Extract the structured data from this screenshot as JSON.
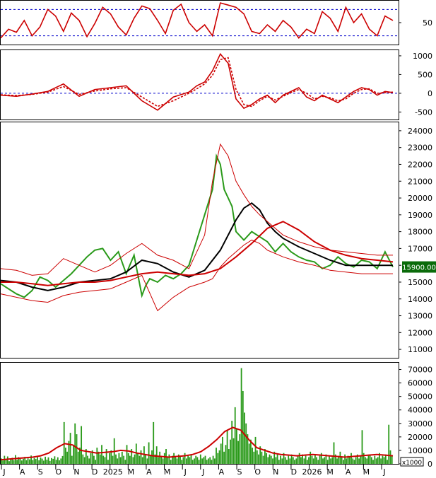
{
  "chart_data": [
    {
      "panel": "oscillator",
      "type": "line",
      "ylim": [
        0,
        100
      ],
      "reference_levels": [
        20,
        80
      ],
      "ticks": [
        50
      ],
      "series": [
        {
          "color": "#cc0000",
          "x": [
            0,
            0.02,
            0.04,
            0.06,
            0.08,
            0.1,
            0.12,
            0.14,
            0.16,
            0.18,
            0.2,
            0.22,
            0.24,
            0.26,
            0.28,
            0.3,
            0.32,
            0.34,
            0.36,
            0.38,
            0.4,
            0.42,
            0.44,
            0.46,
            0.48,
            0.5,
            0.52,
            0.54,
            0.56,
            0.58,
            0.6,
            0.62,
            0.64,
            0.66,
            0.68,
            0.7,
            0.72,
            0.74,
            0.76,
            0.78,
            0.8,
            0.82,
            0.84,
            0.86,
            0.88,
            0.9,
            0.92,
            0.94,
            0.96,
            0.98,
            1.0
          ],
          "values": [
            15,
            35,
            28,
            55,
            20,
            40,
            80,
            65,
            30,
            72,
            55,
            18,
            48,
            85,
            70,
            40,
            22,
            60,
            88,
            82,
            55,
            25,
            78,
            92,
            50,
            30,
            45,
            20,
            95,
            90,
            85,
            70,
            30,
            25,
            45,
            30,
            55,
            40,
            15,
            35,
            25,
            75,
            60,
            30,
            85,
            50,
            70,
            35,
            20,
            65,
            55
          ]
        }
      ]
    },
    {
      "panel": "macd",
      "type": "line",
      "ylim": [
        -700,
        1150
      ],
      "reference_levels": [
        0
      ],
      "ticks": [
        1000,
        500,
        0,
        -500
      ],
      "series": [
        {
          "color": "#cc0000",
          "x": [
            0,
            0.04,
            0.08,
            0.12,
            0.16,
            0.2,
            0.24,
            0.28,
            0.32,
            0.36,
            0.4,
            0.44,
            0.48,
            0.5,
            0.52,
            0.54,
            0.56,
            0.58,
            0.6,
            0.62,
            0.64,
            0.66,
            0.68,
            0.7,
            0.72,
            0.74,
            0.76,
            0.78,
            0.8,
            0.82,
            0.84,
            0.86,
            0.88,
            0.9,
            0.92,
            0.94,
            0.96,
            0.98,
            1.0
          ],
          "values": [
            -50,
            -80,
            -20,
            50,
            250,
            -80,
            100,
            150,
            200,
            -200,
            -450,
            -100,
            30,
            200,
            300,
            600,
            1050,
            800,
            -150,
            -400,
            -300,
            -150,
            -50,
            -250,
            -50,
            50,
            150,
            -100,
            -200,
            -50,
            -150,
            -250,
            -100,
            50,
            150,
            100,
            -50,
            50,
            20
          ]
        },
        {
          "color": "#cc0000",
          "dashed": true,
          "x": [
            0,
            0.04,
            0.08,
            0.12,
            0.16,
            0.2,
            0.24,
            0.28,
            0.32,
            0.36,
            0.4,
            0.44,
            0.48,
            0.5,
            0.52,
            0.54,
            0.56,
            0.58,
            0.6,
            0.62,
            0.64,
            0.66,
            0.68,
            0.7,
            0.72,
            0.74,
            0.76,
            0.78,
            0.8,
            0.82,
            0.84,
            0.86,
            0.88,
            0.9,
            0.92,
            0.94,
            0.96,
            0.98,
            1.0
          ],
          "values": [
            -40,
            -60,
            -30,
            30,
            180,
            -30,
            60,
            120,
            150,
            -100,
            -350,
            -200,
            0,
            120,
            250,
            480,
            900,
            950,
            100,
            -300,
            -350,
            -200,
            -80,
            -180,
            -80,
            20,
            100,
            0,
            -150,
            -80,
            -120,
            -200,
            -150,
            0,
            100,
            120,
            0,
            20,
            30
          ]
        }
      ]
    },
    {
      "panel": "price",
      "type": "line",
      "ylim": [
        10500,
        24500
      ],
      "yticks": [
        24000,
        23000,
        22000,
        21000,
        20000,
        19000,
        18000,
        17000,
        16000,
        15000,
        14000,
        13000,
        12000,
        11000
      ],
      "last_price": "15900.00",
      "x_labels": [
        "J",
        "A",
        "S",
        "O",
        "N",
        "D",
        "2025",
        "M",
        "A",
        "M",
        "J",
        "J",
        "A",
        "S",
        "O",
        "N",
        "D",
        "2026",
        "M",
        "A",
        "M",
        "J"
      ],
      "series": [
        {
          "color": "#2a9a1a",
          "x": [
            0,
            0.02,
            0.04,
            0.06,
            0.08,
            0.1,
            0.12,
            0.14,
            0.16,
            0.18,
            0.2,
            0.22,
            0.24,
            0.26,
            0.28,
            0.3,
            0.32,
            0.34,
            0.36,
            0.37,
            0.38,
            0.4,
            0.42,
            0.44,
            0.46,
            0.48,
            0.5,
            0.52,
            0.54,
            0.55,
            0.56,
            0.57,
            0.58,
            0.59,
            0.6,
            0.62,
            0.64,
            0.66,
            0.68,
            0.7,
            0.72,
            0.74,
            0.76,
            0.78,
            0.8,
            0.82,
            0.84,
            0.86,
            0.88,
            0.9,
            0.92,
            0.94,
            0.96,
            0.98,
            1.0
          ],
          "values": [
            14900,
            14600,
            14300,
            14100,
            14500,
            15300,
            15100,
            14700,
            15100,
            15500,
            16000,
            16500,
            16900,
            17000,
            16300,
            16800,
            15500,
            16600,
            14200,
            14800,
            15200,
            15000,
            15400,
            15200,
            15500,
            16000,
            17500,
            19000,
            20500,
            22500,
            22000,
            20500,
            20000,
            19500,
            18000,
            17500,
            18000,
            17700,
            17400,
            16800,
            17300,
            16800,
            16500,
            16300,
            16200,
            15800,
            16000,
            16500,
            16100,
            15900,
            16300,
            16200,
            15800,
            16800,
            15900
          ]
        },
        {
          "color": "#000000",
          "x": [
            0,
            0.04,
            0.08,
            0.12,
            0.16,
            0.2,
            0.24,
            0.28,
            0.32,
            0.36,
            0.4,
            0.44,
            0.48,
            0.52,
            0.56,
            0.6,
            0.62,
            0.64,
            0.66,
            0.68,
            0.7,
            0.72,
            0.76,
            0.8,
            0.84,
            0.88,
            0.92,
            0.96,
            1.0
          ],
          "values": [
            15100,
            15000,
            14700,
            14500,
            14700,
            15000,
            15100,
            15200,
            15600,
            16300,
            16100,
            15600,
            15300,
            15700,
            16900,
            18700,
            19400,
            19700,
            19300,
            18500,
            18000,
            17600,
            17100,
            16700,
            16300,
            16000,
            16000,
            16000,
            16000
          ]
        },
        {
          "color": "#cc0000",
          "x": [
            0,
            0.04,
            0.08,
            0.12,
            0.16,
            0.2,
            0.24,
            0.28,
            0.32,
            0.36,
            0.4,
            0.44,
            0.48,
            0.52,
            0.56,
            0.6,
            0.64,
            0.68,
            0.72,
            0.76,
            0.8,
            0.84,
            0.88,
            0.92,
            0.96,
            1.0
          ],
          "values": [
            15000,
            15000,
            14900,
            14800,
            14900,
            15000,
            15000,
            15100,
            15300,
            15500,
            15600,
            15500,
            15400,
            15500,
            15800,
            16500,
            17300,
            18200,
            18600,
            18100,
            17400,
            16900,
            16600,
            16400,
            16300,
            16200
          ]
        },
        {
          "color": "#cc0000",
          "thin": true,
          "x": [
            0,
            0.04,
            0.08,
            0.12,
            0.16,
            0.2,
            0.24,
            0.28,
            0.32,
            0.36,
            0.4,
            0.44,
            0.48,
            0.52,
            0.54,
            0.56,
            0.58,
            0.6,
            0.62,
            0.64,
            0.66,
            0.68,
            0.7,
            0.72,
            0.76,
            0.8,
            0.84,
            0.88,
            0.92,
            0.96,
            1.0
          ],
          "values": [
            15800,
            15700,
            15400,
            15500,
            16400,
            16000,
            15600,
            16000,
            16700,
            17300,
            16600,
            16300,
            15800,
            17800,
            21000,
            23200,
            22500,
            21000,
            20200,
            19500,
            19000,
            18600,
            18200,
            17800,
            17400,
            17100,
            16900,
            16800,
            16700,
            16600,
            16600
          ]
        },
        {
          "color": "#cc0000",
          "thin": true,
          "x": [
            0,
            0.04,
            0.08,
            0.12,
            0.16,
            0.2,
            0.24,
            0.28,
            0.32,
            0.36,
            0.4,
            0.44,
            0.48,
            0.52,
            0.54,
            0.56,
            0.58,
            0.6,
            0.62,
            0.64,
            0.66,
            0.68,
            0.7,
            0.72,
            0.76,
            0.8,
            0.84,
            0.88,
            0.92,
            0.96,
            1.0
          ],
          "values": [
            14300,
            14100,
            13900,
            13800,
            14200,
            14400,
            14500,
            14600,
            15000,
            15400,
            13300,
            14100,
            14700,
            15000,
            15200,
            15900,
            16400,
            16800,
            17200,
            17500,
            17300,
            16900,
            16700,
            16500,
            16200,
            16000,
            15700,
            15600,
            15500,
            15500,
            15500
          ]
        }
      ]
    },
    {
      "panel": "volume",
      "type": "bar",
      "ylim": [
        0,
        75000
      ],
      "yticks": [
        70000,
        60000,
        50000,
        40000,
        30000,
        20000,
        10000,
        0
      ],
      "unit": "x1000",
      "values": [
        4000,
        2500,
        6000,
        3000,
        5500,
        2000,
        3500,
        4500,
        2800,
        6500,
        3000,
        5000,
        4000,
        2500,
        3800,
        5200,
        2700,
        4100,
        3300,
        6200,
        2900,
        4400,
        3600,
        5100,
        2600,
        4700,
        3900,
        2400,
        5300,
        3100,
        4800,
        2200,
        4300,
        3700,
        5600,
        3000,
        4900,
        2600,
        4000,
        5800,
        31000,
        12000,
        9000,
        17000,
        23000,
        6000,
        14000,
        30000,
        22000,
        9000,
        12000,
        28000,
        7000,
        5000,
        11000,
        6000,
        4000,
        8000,
        10000,
        6000,
        3000,
        12000,
        9000,
        7000,
        14000,
        6000,
        5000,
        11000,
        3000,
        8000,
        10000,
        6000,
        19000,
        7000,
        4000,
        8000,
        5000,
        9000,
        6000,
        3000,
        14000,
        8000,
        6000,
        11000,
        5000,
        7000,
        15000,
        8000,
        6000,
        10000,
        5000,
        13000,
        7000,
        4000,
        16000,
        6000,
        10000,
        31000,
        7000,
        13000,
        5000,
        9000,
        6000,
        4000,
        8000,
        11000,
        5000,
        7000,
        3000,
        6000,
        8000,
        5000,
        4000,
        7000,
        6000,
        3000,
        5000,
        8000,
        4000,
        6000,
        5000,
        7000,
        3000,
        4000,
        6000,
        5000,
        3000,
        7000,
        4000,
        5000,
        6000,
        3000,
        4000,
        5000,
        3000,
        6000,
        4000,
        12000,
        8000,
        10000,
        15000,
        20000,
        9000,
        14000,
        25000,
        11000,
        18000,
        32000,
        19000,
        42000,
        26000,
        17000,
        22000,
        71000,
        54000,
        38000,
        30000,
        22000,
        15000,
        18000,
        12000,
        9000,
        20000,
        10000,
        7000,
        13000,
        9000,
        6000,
        11000,
        8000,
        5000,
        7000,
        6000,
        4000,
        9000,
        5000,
        7000,
        3000,
        6000,
        4000,
        8000,
        5000,
        3000,
        6000,
        4000,
        7000,
        5000,
        3000,
        4000,
        6000,
        8000,
        5000,
        7000,
        4000,
        6000,
        3000,
        5000,
        9000,
        6000,
        4000,
        7000,
        5000,
        3000,
        6000,
        8000,
        4000,
        5000,
        7000,
        3000,
        6000,
        4000,
        5000,
        16000,
        7000,
        4000,
        6000,
        9000,
        5000,
        3000,
        7000,
        4000,
        6000,
        5000,
        8000,
        4000,
        3000,
        5000,
        7000,
        4000,
        6000,
        25000,
        8000,
        5000,
        4000,
        6000,
        7000,
        5000,
        3000,
        6000,
        4000,
        5000,
        8000,
        4000,
        6000,
        5000,
        7000,
        3000,
        29000,
        10000,
        6000
      ],
      "ma": [
        3000,
        3500,
        4000,
        4500,
        5000,
        6000,
        8000,
        12000,
        15000,
        14000,
        10000,
        9000,
        8000,
        8500,
        9000,
        10000,
        9500,
        8000,
        7000,
        6000,
        5500,
        5000,
        5500,
        6000,
        7000,
        9000,
        13000,
        18000,
        24000,
        27000,
        25000,
        18000,
        12000,
        10000,
        8000,
        7000,
        6500,
        6000,
        6500,
        7000,
        6500,
        6000,
        5500,
        5000,
        5500,
        6000,
        6500,
        7000,
        6500,
        6000
      ]
    }
  ]
}
